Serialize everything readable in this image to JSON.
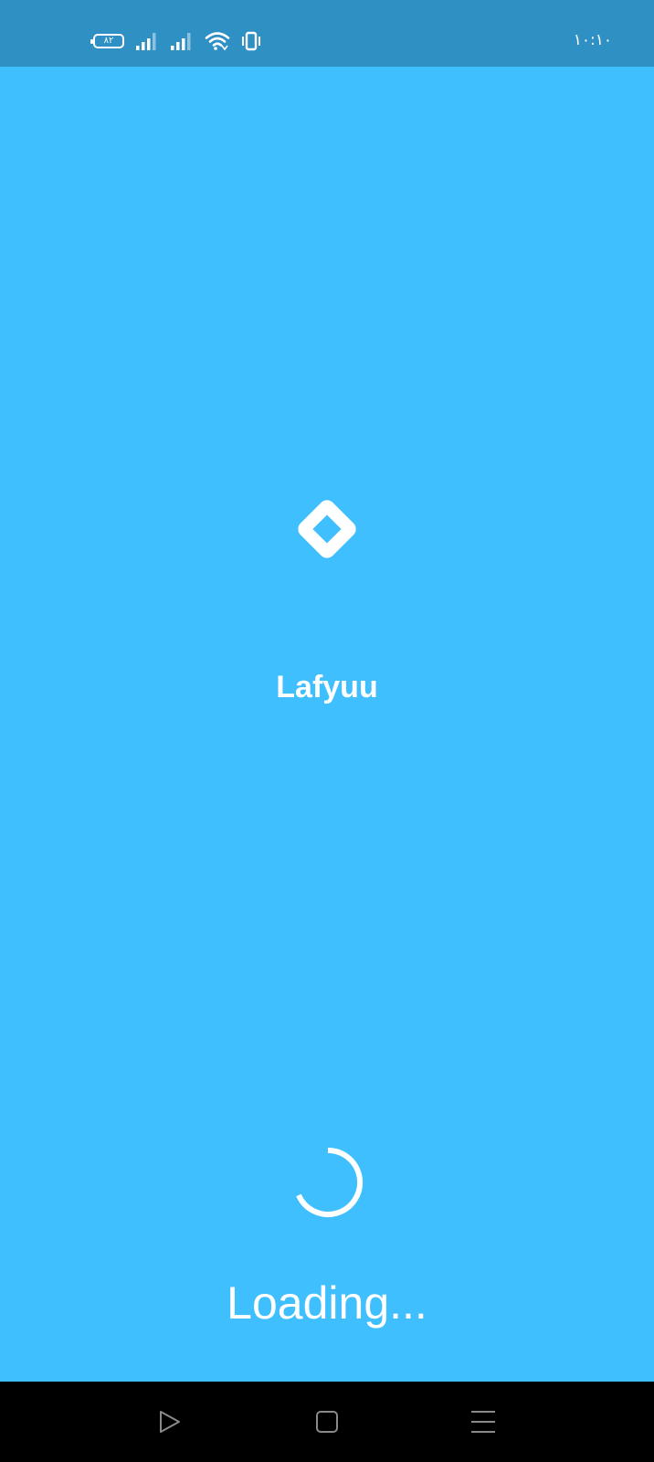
{
  "status_bar": {
    "battery_level": "۸۲",
    "time": "۱۰:۱۰",
    "icons": [
      "battery-icon",
      "signal-icon",
      "signal-icon",
      "wifi-icon",
      "vibrate-icon"
    ]
  },
  "splash": {
    "logo_icon": "diamond-logo-icon",
    "app_name": "Lafyuu",
    "loading_text": "Loading..."
  },
  "nav_bar": {
    "buttons": [
      "back-triangle-icon",
      "home-square-icon",
      "menu-lines-icon"
    ]
  },
  "colors": {
    "background": "#40BFFF",
    "status_bar": "#2F90C4",
    "foreground": "#FFFFFF",
    "nav_bar": "#000000"
  }
}
